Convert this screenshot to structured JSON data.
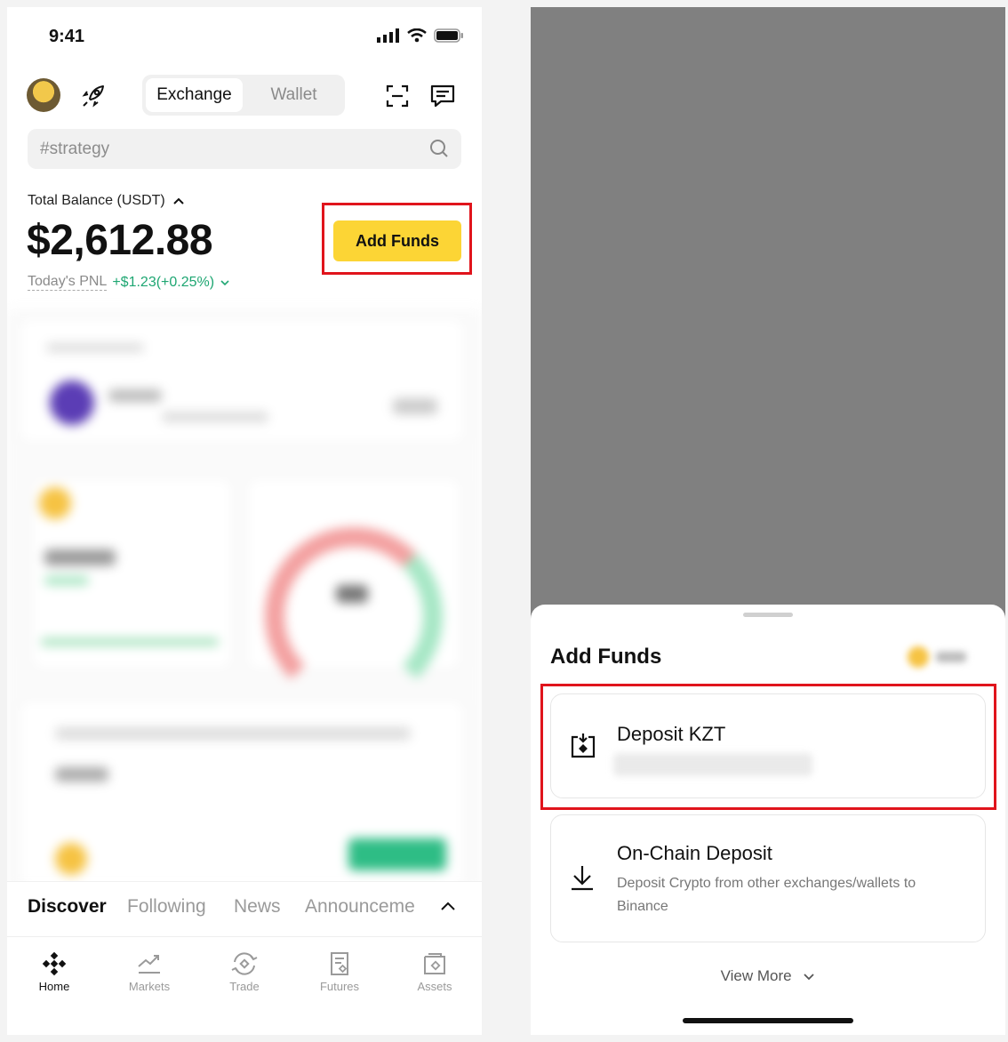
{
  "status": {
    "time": "9:41"
  },
  "header": {
    "tabs": [
      {
        "label": "Exchange",
        "active": true
      },
      {
        "label": "Wallet",
        "active": false
      }
    ]
  },
  "search": {
    "placeholder": "#strategy"
  },
  "balance": {
    "label": "Total Balance (USDT)",
    "value": "$2,612.88",
    "pnl_label": "Today's PNL",
    "pnl_value": "+$1.23(+0.25%)",
    "add_funds_label": "Add Funds"
  },
  "feed_tabs": [
    "Discover",
    "Following",
    "News",
    "Announceme"
  ],
  "bottom_nav": [
    "Home",
    "Markets",
    "Trade",
    "Futures",
    "Assets"
  ],
  "sheet": {
    "title": "Add Funds",
    "options": [
      {
        "title": "Deposit KZT",
        "subtitle": ""
      },
      {
        "title": "On-Chain Deposit",
        "subtitle": "Deposit Crypto from other exchanges/wallets to Binance"
      }
    ],
    "view_more": "View More"
  },
  "colors": {
    "brand_yellow": "#fcd535",
    "highlight_red": "#e0141c",
    "pnl_green": "#1ea672"
  },
  "icons": [
    "avatar",
    "rocket-icon",
    "scan-icon",
    "message-icon",
    "search-icon",
    "chevron-up-icon",
    "chevron-down-icon",
    "binance-logo-icon",
    "markets-icon",
    "trade-icon",
    "futures-icon",
    "assets-icon",
    "deposit-fiat-icon",
    "download-icon"
  ]
}
